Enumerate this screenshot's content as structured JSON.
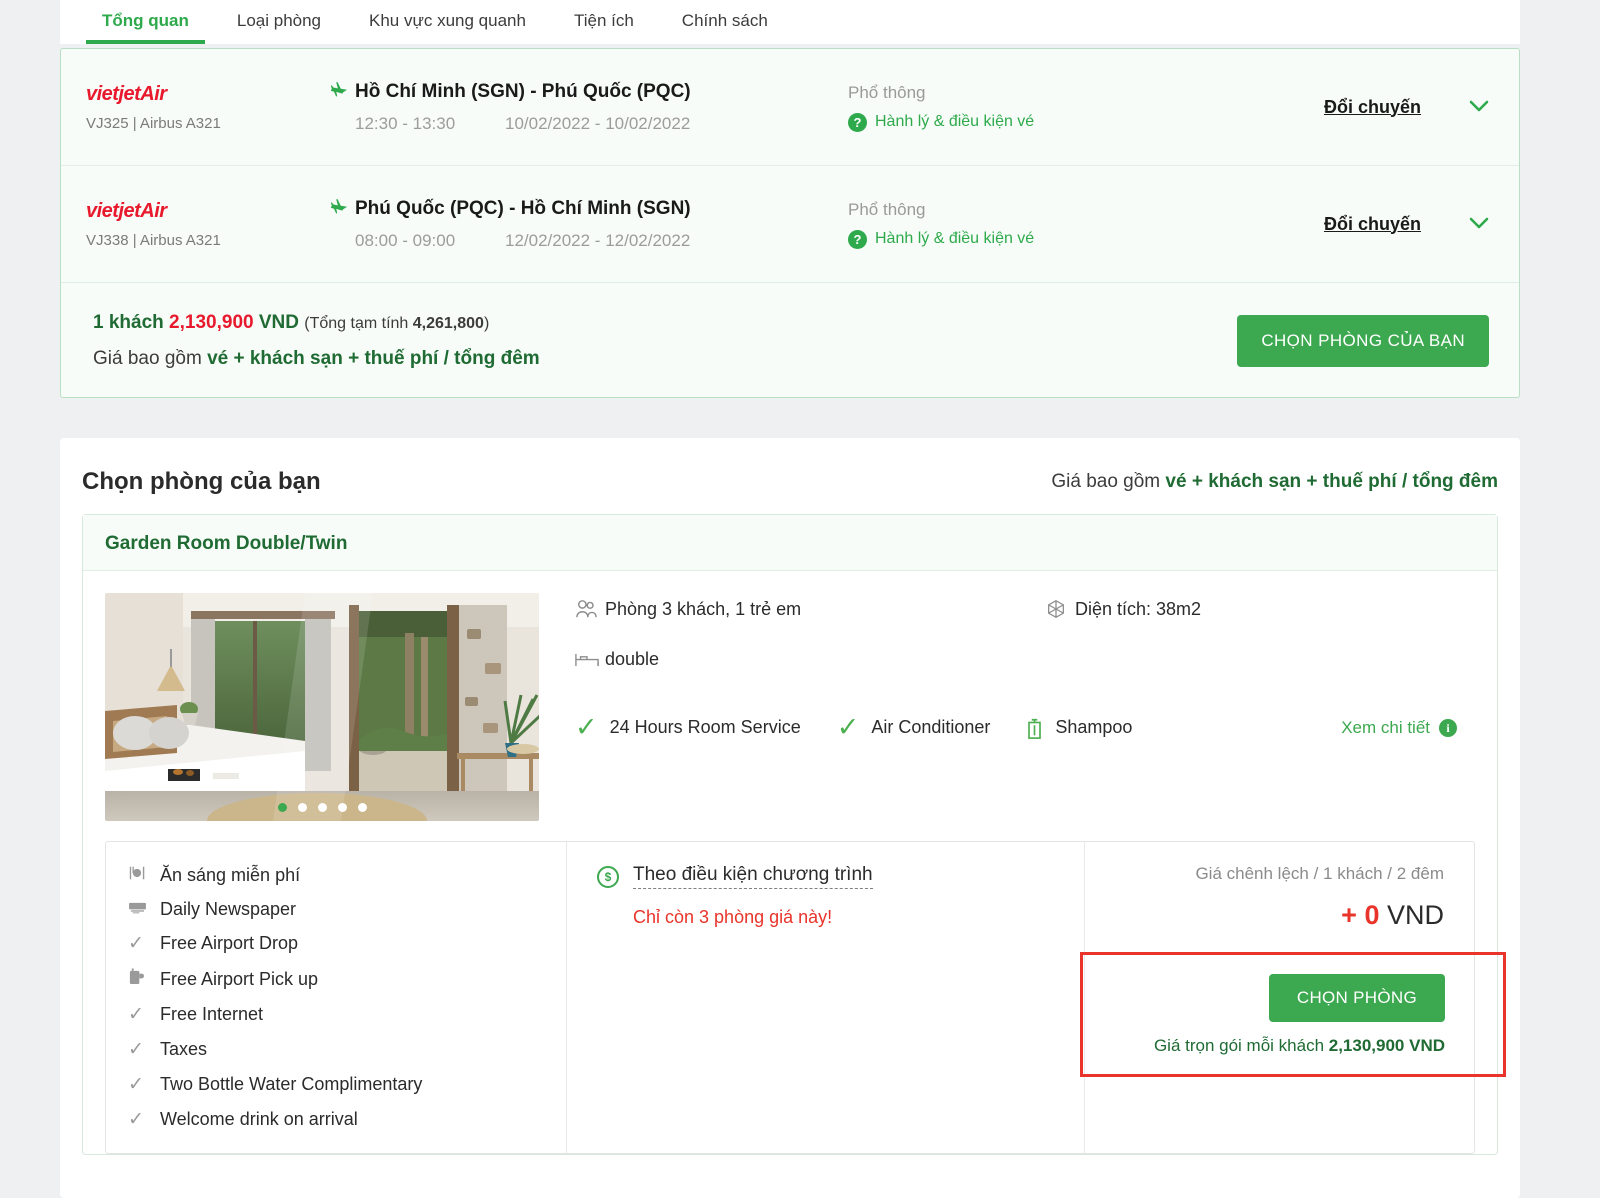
{
  "tabs": [
    {
      "label": "Tổng quan",
      "active": true
    },
    {
      "label": "Loại phòng",
      "active": false
    },
    {
      "label": "Khu vực xung quanh",
      "active": false
    },
    {
      "label": "Tiện ích",
      "active": false
    },
    {
      "label": "Chính sách",
      "active": false
    }
  ],
  "flights": [
    {
      "airline": "vietjetAir",
      "code": "VJ325 | Airbus A321",
      "route": "Hồ Chí Minh (SGN) - Phú Quốc (PQC)",
      "time": "12:30 - 13:30",
      "dates": "10/02/2022 - 10/02/2022",
      "cabin": "Phổ thông",
      "baggage": "Hành lý & điều kiện vé",
      "change_label": "Đổi chuyến",
      "chevron": "chevron-down"
    },
    {
      "airline": "vietjetAir",
      "code": "VJ338 | Airbus A321",
      "route": "Phú Quốc (PQC) - Hồ Chí Minh (SGN)",
      "time": "08:00 - 09:00",
      "dates": "12/02/2022 - 12/02/2022",
      "cabin": "Phổ thông",
      "baggage": "Hành lý & điều kiện vé",
      "change_label": "Đổi chuyến",
      "chevron": "chevron-down"
    }
  ],
  "summary": {
    "guests": "1 khách",
    "price": "2,130,900",
    "currency": "VND",
    "subtotal_prefix": "(Tổng tạm tính ",
    "subtotal": "4,261,800",
    "subtotal_suffix": ")",
    "includes_prefix": "Giá bao gồm ",
    "includes": "vé + khách sạn + thuế phí / tổng đêm",
    "cta": "CHỌN PHÒNG CỦA BẠN"
  },
  "rooms_section": {
    "title": "Chọn phòng của bạn",
    "note_prefix": "Giá bao gồm ",
    "note_bold": "vé + khách sạn + thuế phí / tổng đêm"
  },
  "room": {
    "name": "Garden Room Double/Twin",
    "carousel": {
      "total": 5,
      "active_index": 0
    },
    "occupancy": "Phòng 3 khách, 1 trẻ em",
    "area": "Diện tích: 38m2",
    "bed": "double",
    "amenities": [
      {
        "label": "24 Hours Room Service",
        "icon": "check-icon"
      },
      {
        "label": "Air Conditioner",
        "icon": "check-icon"
      },
      {
        "label": "Shampoo",
        "icon": "shampoo-icon"
      }
    ],
    "detail_link": "Xem chi tiết",
    "benefits": [
      {
        "label": "Ăn sáng miễn phí",
        "icon": "cutlery-icon"
      },
      {
        "label": "Daily Newspaper",
        "icon": "newspaper-icon"
      },
      {
        "label": "Free Airport Drop",
        "icon": "check-icon"
      },
      {
        "label": "Free Airport Pick up",
        "icon": "mug-icon"
      },
      {
        "label": "Free Internet",
        "icon": "check-icon"
      },
      {
        "label": "Taxes",
        "icon": "check-icon"
      },
      {
        "label": "Two Bottle Water Complimentary",
        "icon": "check-icon"
      },
      {
        "label": "Welcome drink on arrival",
        "icon": "check-icon"
      }
    ],
    "condition": "Theo điều kiện chương trình",
    "condition_warning": "Chỉ còn 3 phòng giá này!",
    "diff_label": "Giá chênh lệch / 1 khách / 2 đêm",
    "diff_plus": "+",
    "diff_value": "0",
    "diff_currency": "VND",
    "choose_cta": "CHỌN PHÒNG",
    "package_prefix": "Giá trọn gói mỗi khách ",
    "package_price": "2,130,900 VND"
  },
  "colors": {
    "brand_green": "#3ca84f",
    "dark_green": "#1f6b33",
    "red": "#e8342a",
    "airline_red": "#e8192c",
    "page_bg": "#eff0f2"
  }
}
